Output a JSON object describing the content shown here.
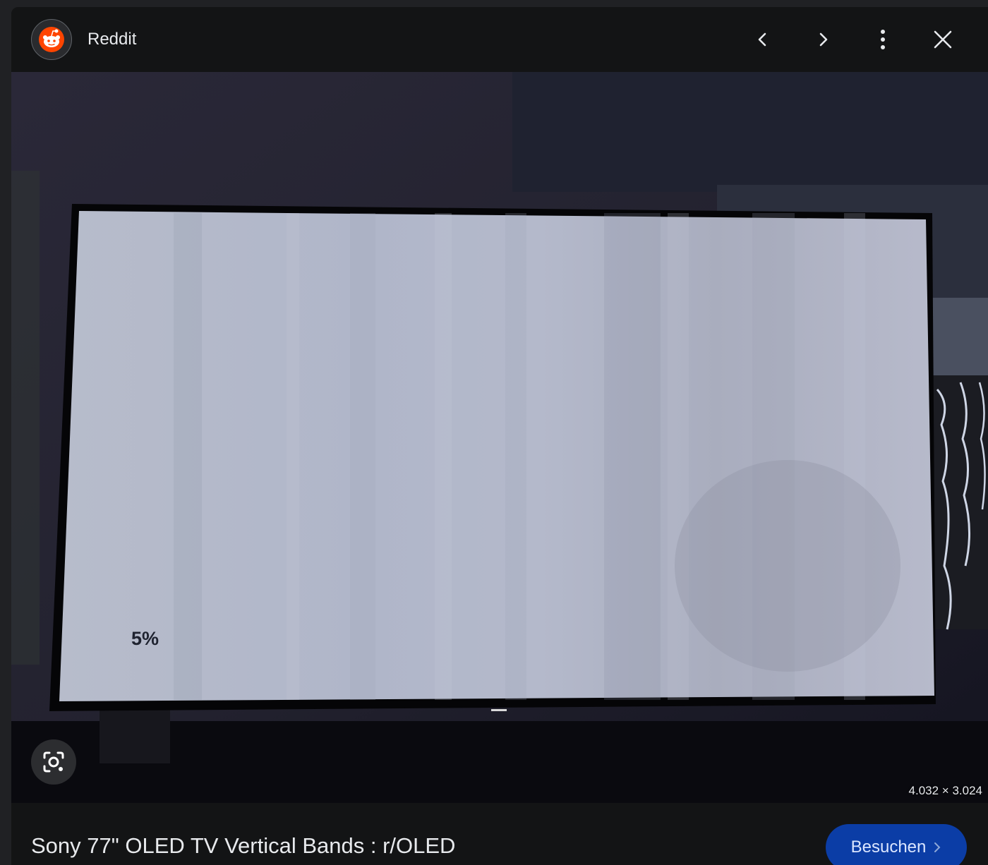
{
  "header": {
    "source_name": "Reddit",
    "icons": {
      "logo": "reddit-logo",
      "prev": "chevron-left-icon",
      "next": "chevron-right-icon",
      "more": "more-vertical-icon",
      "close": "close-icon"
    }
  },
  "image": {
    "on_screen_text": "5%",
    "dimensions": "4.032 × 3.024",
    "lens_icon": "lens-search-icon"
  },
  "footer": {
    "title": "Sony 77\" OLED TV Vertical Bands : r/OLED",
    "visit_label": "Besuchen",
    "visit_icon": "chevron-right-icon"
  },
  "colors": {
    "panel_bg": "#131415",
    "visit_button_bg": "#0b3da6",
    "reddit_orange": "#ff4500"
  }
}
